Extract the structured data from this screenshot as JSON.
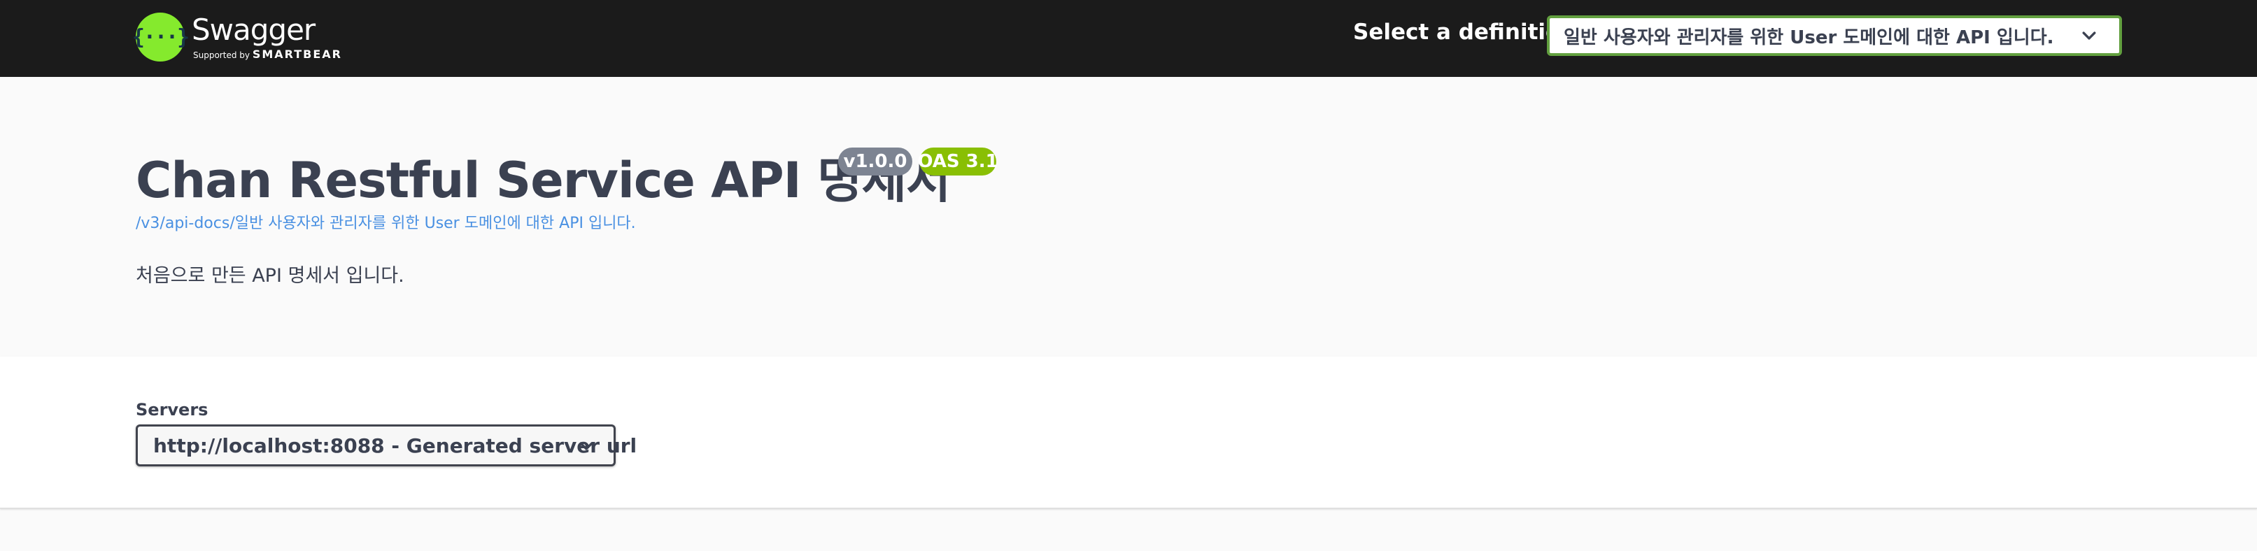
{
  "topbar": {
    "logo_glyph": "{···}",
    "brand": "Swagger",
    "supported_by": "Supported by",
    "smartbear": "SMARTBEAR",
    "definition_label": "Select a definition",
    "definition_selected": "일반 사용자와 관리자를 위한 User 도메인에 대한 API 입니다.",
    "chevron_icon": "chevron-down-icon"
  },
  "info": {
    "title": "Chan Restful Service API 명세서",
    "version_badge": "v1.0.0",
    "oas_badge": "OAS 3.1",
    "api_docs_link": "/v3/api-docs/일반 사용자와 관리자를 위한 User 도메인에 대한 API 입니다.",
    "description": "처음으로 만든 API 명세서 입니다."
  },
  "servers": {
    "label": "Servers",
    "selected": "http://localhost:8088 - Generated server url"
  },
  "colors": {
    "topbar_bg": "#1b1b1b",
    "logo_green": "#85ea2d",
    "select_border_green": "#62a03f",
    "version_badge": "#7d8492",
    "oas_badge": "#89bf04",
    "link": "#4990e2",
    "text": "#3b4151"
  }
}
